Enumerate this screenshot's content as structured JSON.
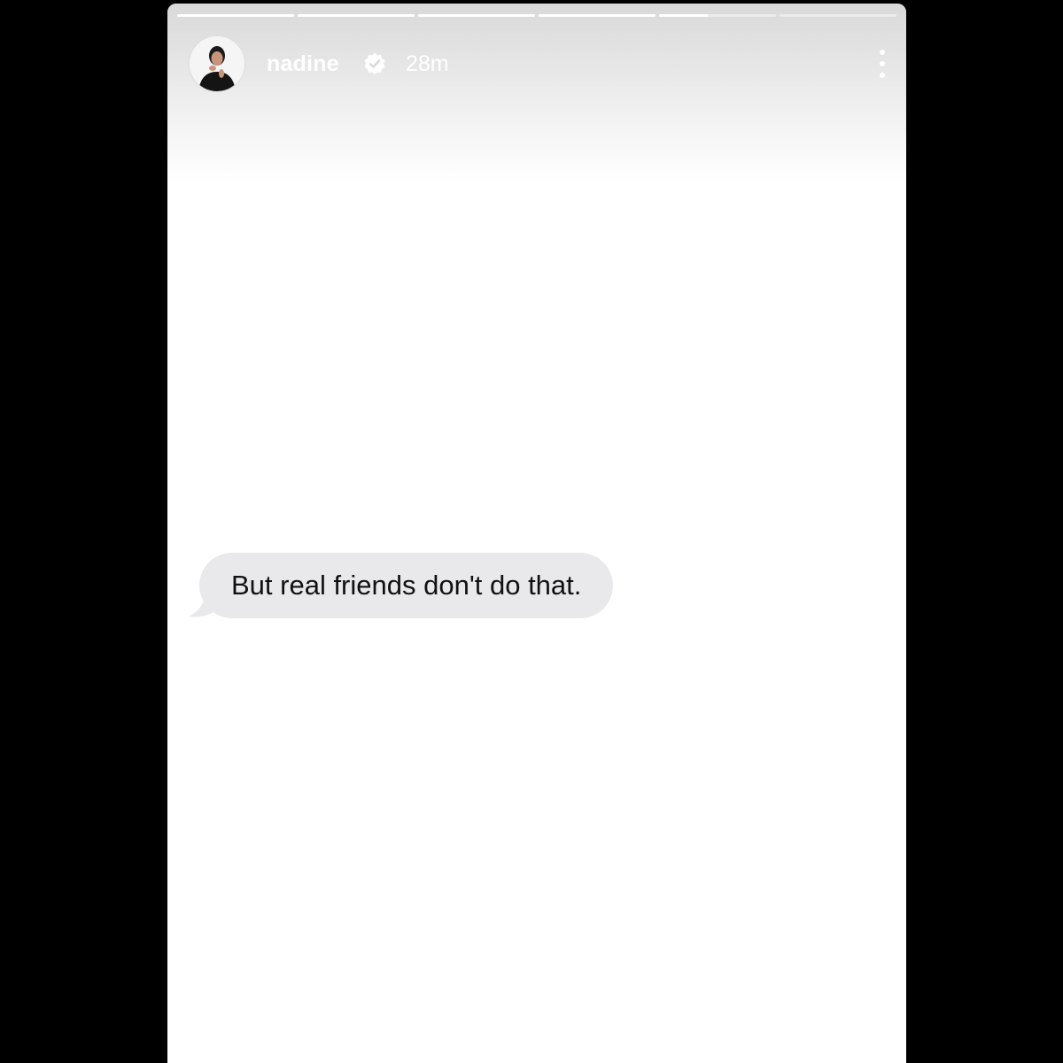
{
  "story": {
    "progress_segments": [
      1,
      1,
      1,
      1,
      0.42,
      0
    ],
    "header": {
      "username": "nadine",
      "verified_icon": "verified-badge-icon",
      "timestamp": "28m",
      "more_icon": "more-vertical-icon",
      "avatar_alt": "profile-avatar"
    },
    "message": {
      "text": "But real friends don't do that."
    }
  },
  "colors": {
    "background": "#000000",
    "story_bg": "#ffffff",
    "bubble": "#e9e9eb",
    "text": "#111111"
  }
}
